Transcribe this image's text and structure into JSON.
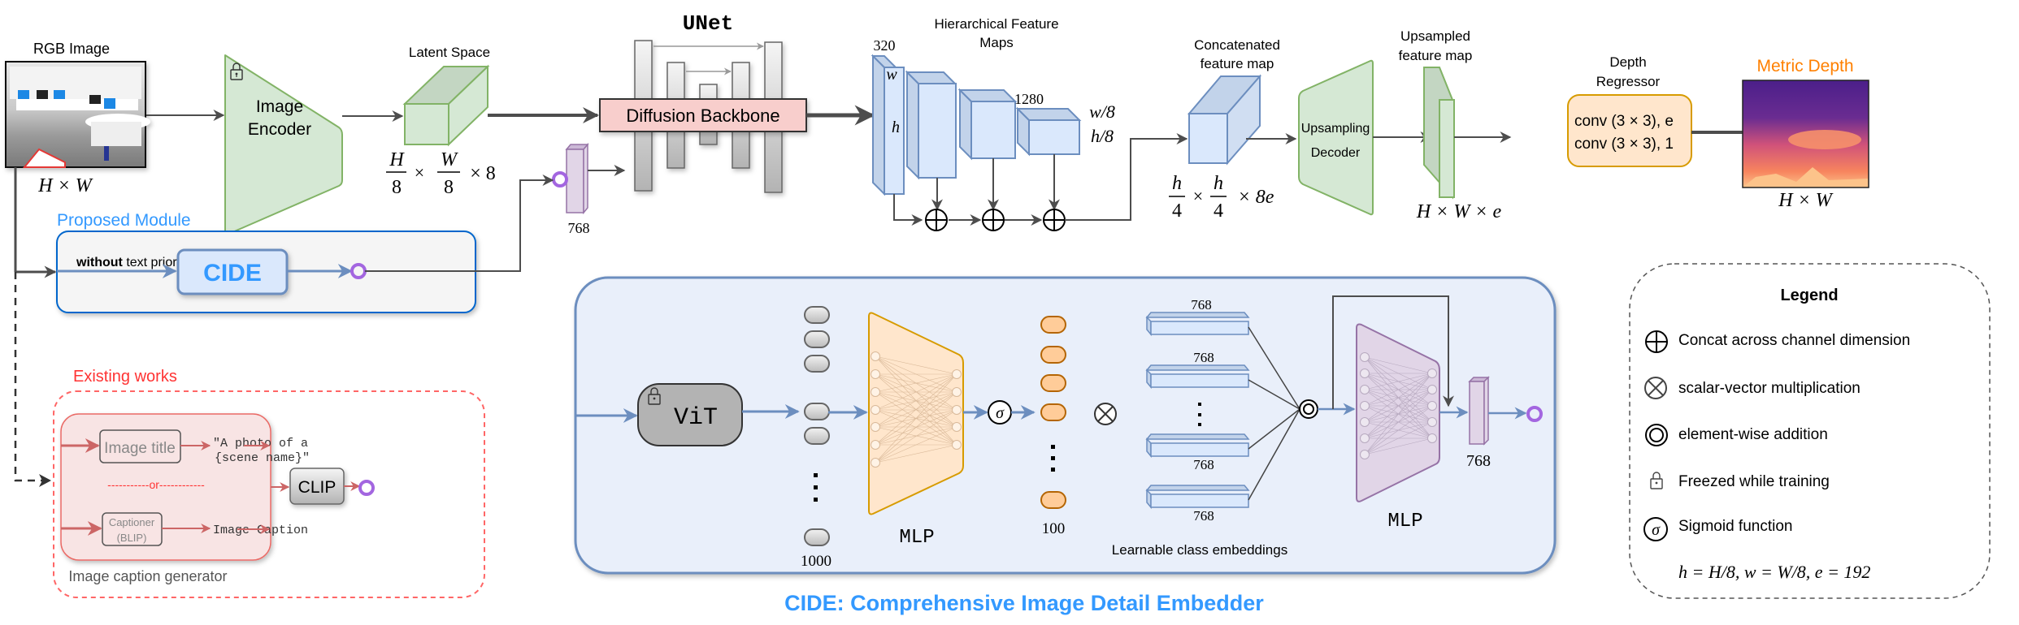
{
  "top_pipeline": {
    "rgb_image": {
      "label": "RGB Image",
      "dims": "H × W"
    },
    "image_encoder": {
      "line1": "Image",
      "line2": "Encoder",
      "frozen": true
    },
    "latent_space": {
      "label": "Latent Space",
      "dims_h": "H",
      "dims_w": "W",
      "dims_den": "8",
      "dims_c": "× 8"
    },
    "text_embedding": {
      "dim": "768"
    },
    "unet": {
      "title": "UNet",
      "backbone_label": "Diffusion Backbone"
    },
    "hier_features": {
      "title_line1": "Hierarchical Feature",
      "title_line2": "Maps",
      "first_channels": "320",
      "first_w": "w",
      "first_h": "h",
      "last_channels": "1280",
      "last_w": "w/8",
      "last_h": "h/8"
    },
    "concat_map": {
      "line1": "Concatenated",
      "line2": "feature map",
      "num": "h",
      "den": "4",
      "tail": "× 8e"
    },
    "upsampling_decoder": {
      "line1": "Upsampling",
      "line2": "Decoder"
    },
    "upsampled_map": {
      "line1": "Upsampled",
      "line2": "feature map",
      "dims": "H × W × e"
    },
    "depth_regressor": {
      "line1": "Depth",
      "line2": "Regressor",
      "conv1": "conv (3 × 3), e",
      "conv2": "conv (3 × 3), 1"
    },
    "metric_depth": {
      "label": "Metric Depth",
      "dims": "H × W"
    }
  },
  "proposed_module": {
    "title": "Proposed Module",
    "input_bold": "without",
    "input_rest": " text priors",
    "block_label": "CIDE"
  },
  "existing_works": {
    "title": "Existing works",
    "image_title_box": "Image title",
    "template_line1": "\"A photo of a",
    "template_line2": "{scene name}\"",
    "or_label": "-----------or------------",
    "captioner_line1": "Captioner",
    "captioner_line2": "(BLIP)",
    "caption_output": "Image Caption",
    "clip_label": "CLIP",
    "generator_label": "Image caption generator"
  },
  "cide_panel": {
    "vit_label": "ViT",
    "logits_count": "1000",
    "mlp1_label": "MLP",
    "sigma": "σ",
    "probs_count": "100",
    "embedding_dims": [
      "768",
      "768",
      "768",
      "768"
    ],
    "embeddings_label": "Learnable class embeddings",
    "mlp2_label": "MLP",
    "output_dim": "768",
    "caption": "CIDE: Comprehensive Image Detail Embedder"
  },
  "legend": {
    "title": "Legend",
    "items": [
      {
        "icon": "concat-icon",
        "label": "Concat across channel dimension"
      },
      {
        "icon": "scalar-multiply-icon",
        "label": "scalar-vector multiplication"
      },
      {
        "icon": "elementwise-add-icon",
        "label": "element-wise addition"
      },
      {
        "icon": "lock-icon",
        "label": "Freezed while training"
      },
      {
        "icon": "sigmoid-icon",
        "label": "Sigmoid function"
      }
    ],
    "formula": "h = H/8, w = W/8, e = 192"
  },
  "colors": {
    "arrow_dark": "#4d4d4d",
    "arrow_blue": "#6c8ebf",
    "green_fill": "#d5e8d4",
    "green_stroke": "#82b366",
    "blue_fill": "#dae8fc",
    "blue_stroke": "#6c8ebf",
    "pink_fill": "#f8cecc",
    "orange_fill": "#ffe6cc",
    "orange_stroke": "#d79b00",
    "purple_fill": "#e1d5e7",
    "purple_stroke": "#9673a6",
    "connector_purple": "#a366e0",
    "proposed_blue": "#3399ff",
    "existing_red": "#ff3333",
    "metric_orange": "#ff8000"
  }
}
